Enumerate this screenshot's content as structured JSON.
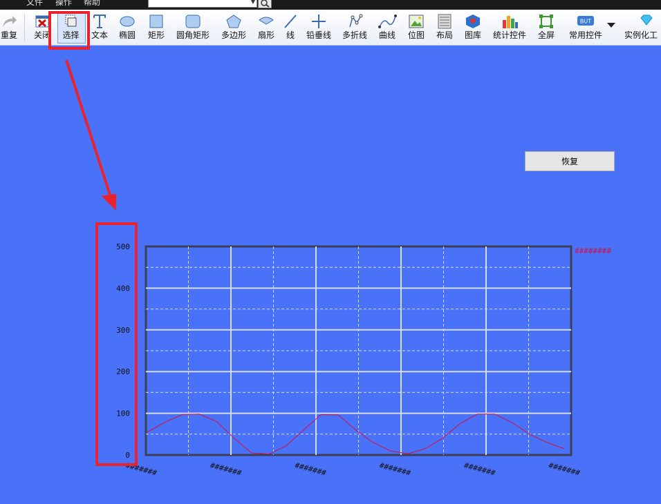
{
  "menu": {
    "items": [
      "文件",
      "操作",
      "帮助"
    ]
  },
  "toolbar": {
    "tools": [
      {
        "label": "重复"
      },
      {
        "label": "关闭"
      },
      {
        "label": "选择"
      },
      {
        "label": "文本"
      },
      {
        "label": "椭圆"
      },
      {
        "label": "矩形"
      },
      {
        "label": "圆角矩形"
      },
      {
        "label": "多边形"
      },
      {
        "label": "扇形"
      },
      {
        "label": "线"
      },
      {
        "label": "铅垂线"
      },
      {
        "label": "多折线"
      },
      {
        "label": "曲线"
      },
      {
        "label": "位图"
      },
      {
        "label": "布局"
      },
      {
        "label": "图库"
      },
      {
        "label": "统计控件"
      },
      {
        "label": "全屏"
      },
      {
        "label": "常用控件"
      },
      {
        "label": "实例化工"
      }
    ],
    "common_controls_badge": "BUT"
  },
  "restore_button": {
    "label": "恢复"
  },
  "colors": {
    "background": "#4a72f8",
    "highlight": "#e8232e",
    "series": "#d01040"
  },
  "chart_data": {
    "type": "line",
    "ylim": [
      0,
      500
    ],
    "yticks": [
      0,
      100,
      200,
      300,
      400,
      500
    ],
    "xtick_labels": [
      "#######",
      "#######",
      "#######",
      "#######",
      "#######",
      "#######"
    ],
    "legend": [
      "########"
    ],
    "grid": true,
    "series": [
      {
        "points": [
          [
            0,
            55
          ],
          [
            0.5,
            78
          ],
          [
            1,
            97
          ],
          [
            1.5,
            98
          ],
          [
            2,
            80
          ],
          [
            2.5,
            40
          ],
          [
            3,
            5
          ],
          [
            3.5,
            2
          ],
          [
            4,
            22
          ],
          [
            4.5,
            60
          ],
          [
            5,
            97
          ],
          [
            5.5,
            96
          ],
          [
            6,
            60
          ],
          [
            6.5,
            30
          ],
          [
            7,
            10
          ],
          [
            7.5,
            3
          ],
          [
            8,
            15
          ],
          [
            8.5,
            40
          ],
          [
            9,
            75
          ],
          [
            9.5,
            98
          ],
          [
            10,
            98
          ],
          [
            10.5,
            78
          ],
          [
            11,
            50
          ],
          [
            11.5,
            30
          ],
          [
            12,
            15
          ]
        ]
      }
    ]
  }
}
